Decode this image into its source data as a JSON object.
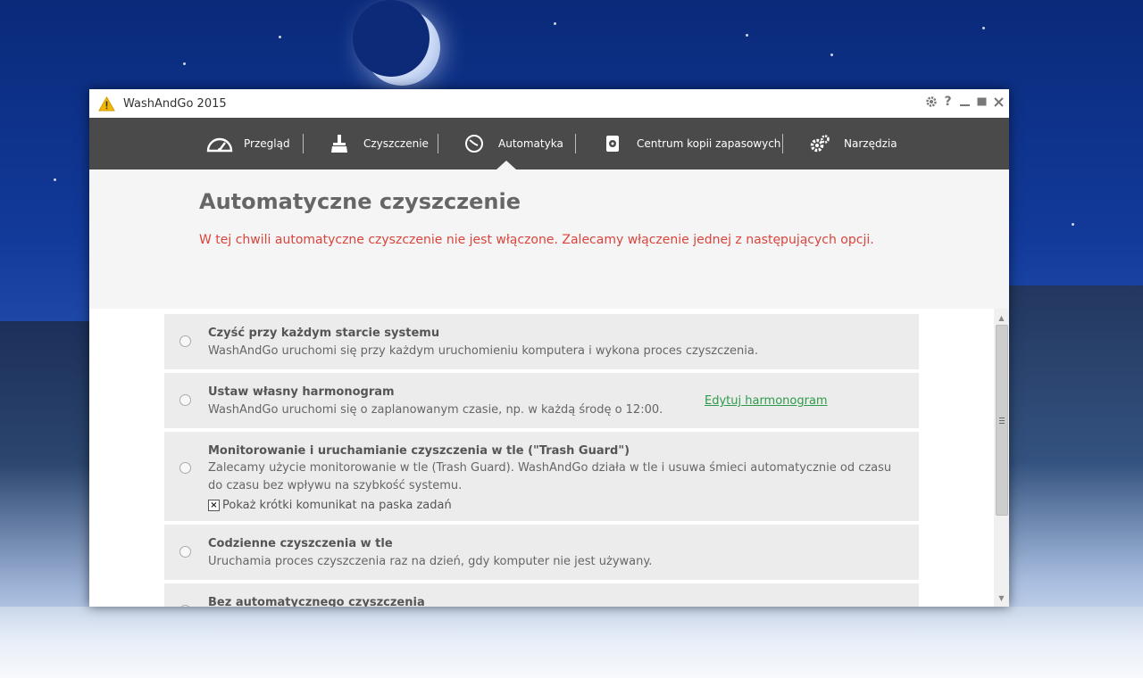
{
  "window": {
    "title": "WashAndGo 2015"
  },
  "nav": {
    "items": [
      {
        "label": "Przegląd",
        "icon": "speedometer-icon"
      },
      {
        "label": "Czyszczenie",
        "icon": "broom-icon"
      },
      {
        "label": "Automatyka",
        "icon": "clock-icon",
        "active": true
      },
      {
        "label": "Centrum kopii zapasowych",
        "icon": "backup-disk-icon"
      },
      {
        "label": "Narzędzia",
        "icon": "gears-icon"
      }
    ]
  },
  "header": {
    "title": "Automatyczne czyszczenie",
    "warning": "W tej chwili automatyczne czyszczenie nie jest włączone. Zalecamy włączenie jednej z następujących opcji."
  },
  "options": [
    {
      "title": "Czyść przy każdym starcie systemu",
      "desc": "WashAndGo uruchomi się przy każdym uruchomieniu komputera i wykona proces czyszczenia."
    },
    {
      "title": "Ustaw własny harmonogram",
      "desc": "WashAndGo uruchomi się o zaplanowanym czasie, np. w każdą środę o 12:00.",
      "link": "Edytuj harmonogram"
    },
    {
      "title": "Monitorowanie i uruchamianie czyszczenia w tle (\"Trash Guard\")",
      "desc": "Zalecamy użycie monitorowanie w tle (Trash Guard). WashAndGo działa w tle i usuwa śmieci automatycznie od czasu do czasu bez wpływu na szybkość systemu.",
      "checkbox": {
        "label": "Pokaż krótki komunikat na paska zadań",
        "checked": true,
        "mark": "×"
      }
    },
    {
      "title": "Codzienne czyszczenia w tle",
      "desc": "Uruchamia proces czyszczenia raz na dzień, gdy komputer nie jest używany."
    },
    {
      "title": "Bez automatycznego czyszczenia"
    }
  ],
  "colors": {
    "navbar": "#4a4a4a",
    "warning": "#d9443c",
    "link": "#2e9b4a",
    "option_bg": "#ececec"
  }
}
